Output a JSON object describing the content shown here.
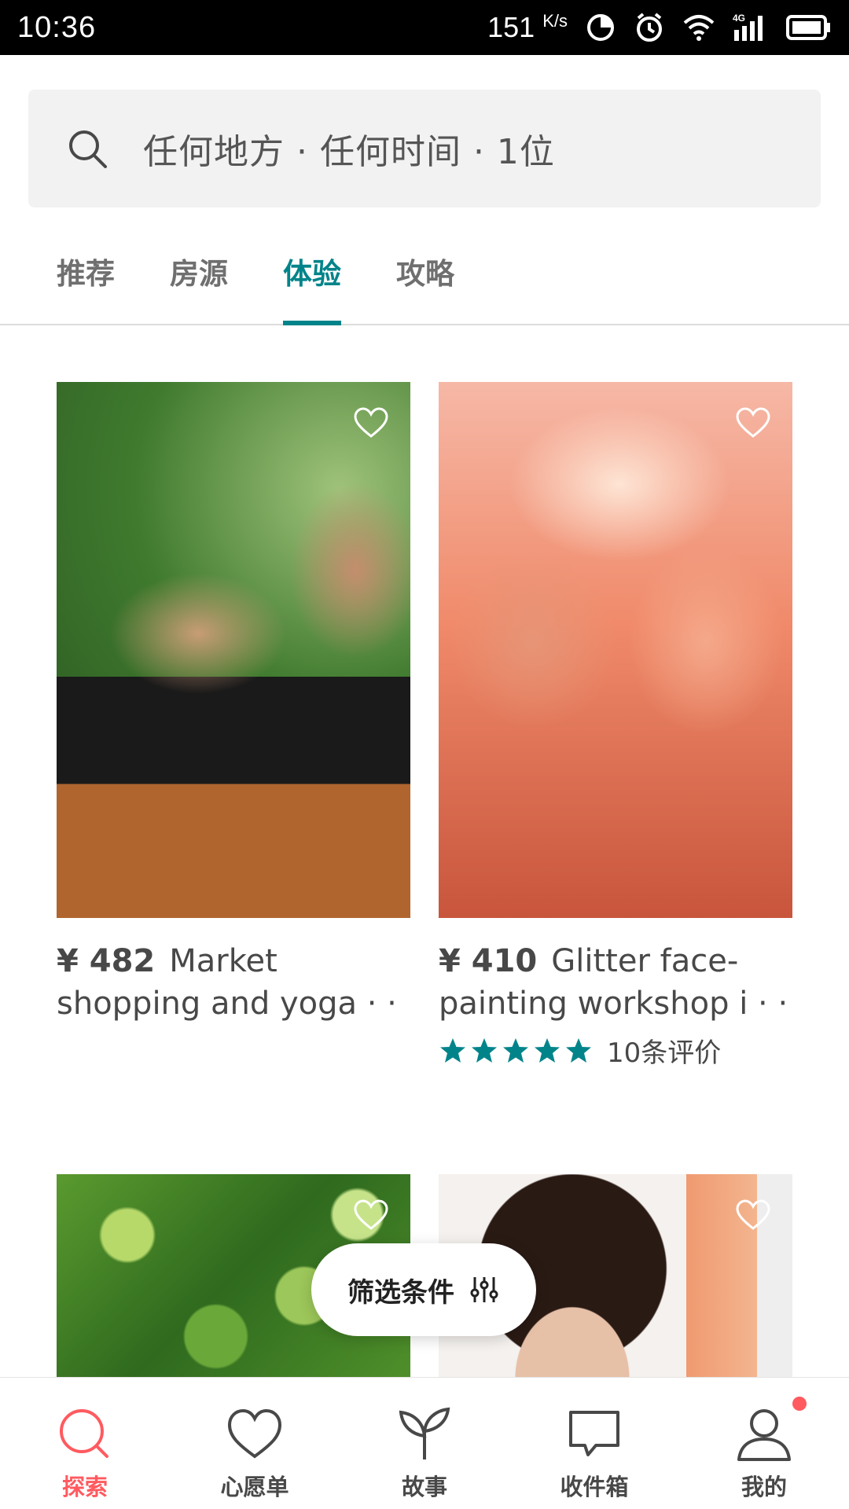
{
  "status_bar": {
    "time": "10:36",
    "speed": "151",
    "speed_unit": "K/s",
    "icons": [
      "data-saver-icon",
      "alarm-icon",
      "wifi-icon",
      "4g-signal-icon",
      "battery-icon"
    ]
  },
  "search": {
    "icon": "search-icon",
    "text": "任何地方 · 任何时间 · 1位"
  },
  "tabs": [
    {
      "label": "推荐",
      "active": false
    },
    {
      "label": "房源",
      "active": false
    },
    {
      "label": "体验",
      "active": true
    },
    {
      "label": "攻略",
      "active": false
    }
  ],
  "colors": {
    "accent_teal": "#00848a",
    "brand_red": "#ff5a5f",
    "text": "#484848"
  },
  "experiences": [
    {
      "price": "¥ 482",
      "title": "Market shopping and yoga · ·",
      "image": "yoga-photo",
      "rating_stars": null,
      "reviews": null
    },
    {
      "price": "¥ 410",
      "title": "Glitter face-painting workshop i · ·",
      "image": "face-painting-photo",
      "rating_stars": 5,
      "reviews": "10条评价"
    },
    {
      "image": "leaves-photo"
    },
    {
      "image": "portrait-photo"
    }
  ],
  "filter_button": {
    "label": "筛选条件",
    "icon": "sliders-icon"
  },
  "bottom_nav": [
    {
      "label": "探索",
      "icon": "search-icon",
      "active": true
    },
    {
      "label": "心愿单",
      "icon": "heart-icon",
      "active": false
    },
    {
      "label": "故事",
      "icon": "sprout-icon",
      "active": false
    },
    {
      "label": "收件箱",
      "icon": "chat-bubble-icon",
      "active": false
    },
    {
      "label": "我的",
      "icon": "profile-icon",
      "active": false,
      "notification": true
    }
  ]
}
